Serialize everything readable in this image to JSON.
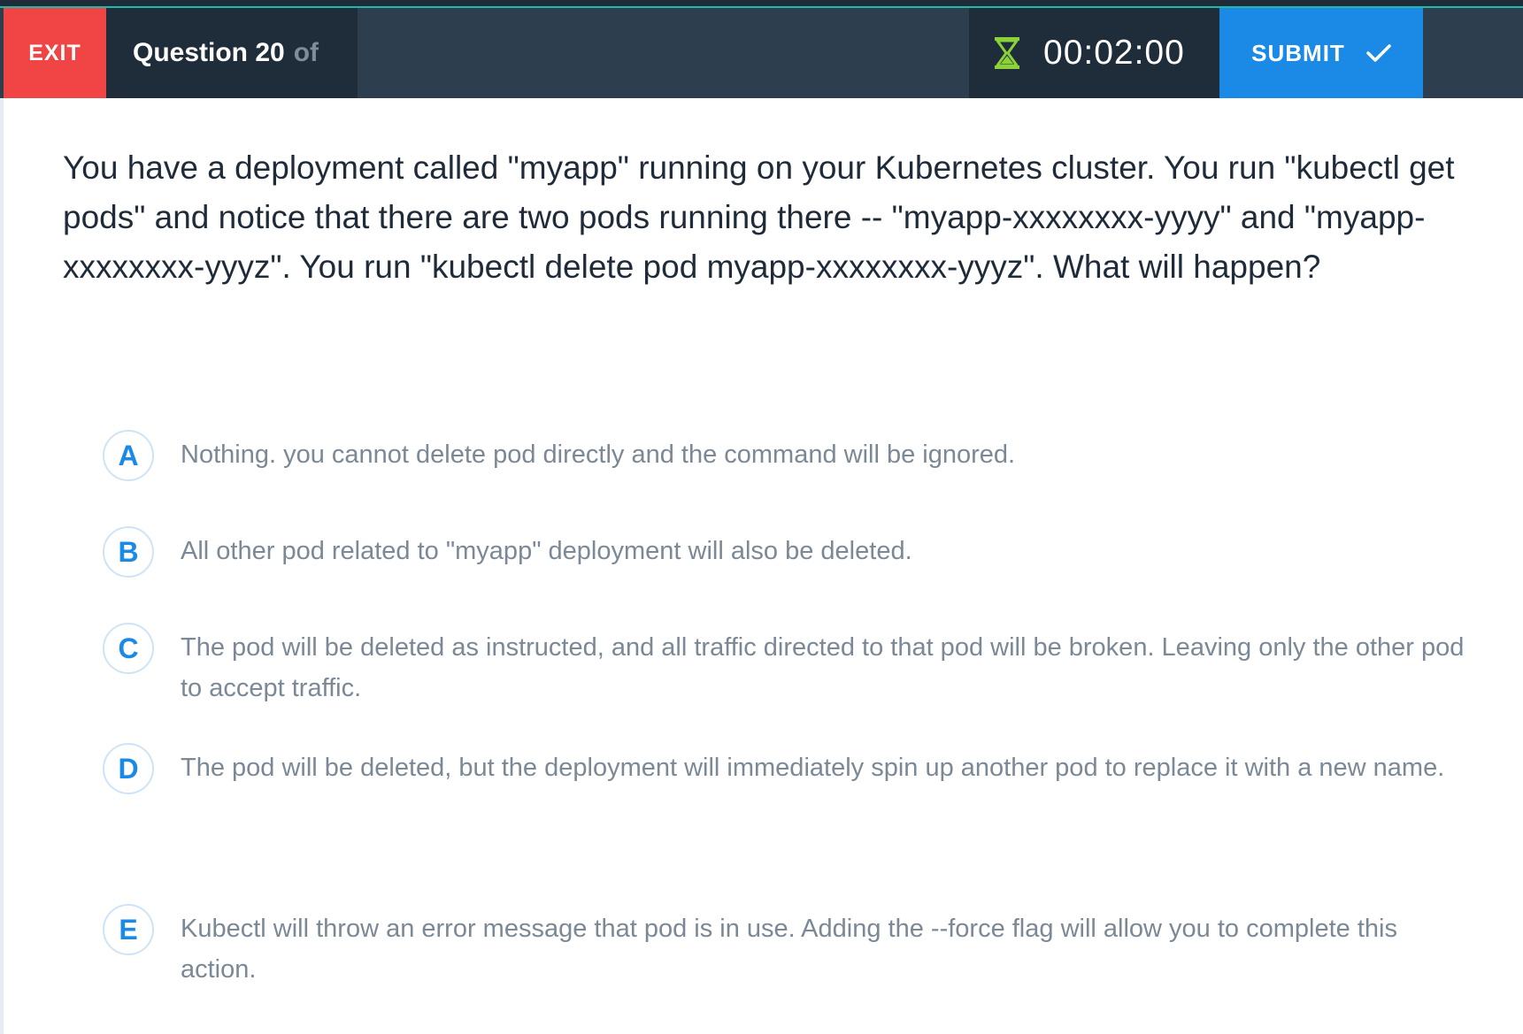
{
  "header": {
    "exit_label": "EXIT",
    "question_label": "Question 20",
    "question_of": "of",
    "timer_value": "00:02:00",
    "submit_label": "SUBMIT",
    "icons": {
      "timer": "hourglass-icon",
      "submit": "checkmark-icon"
    },
    "colors": {
      "exit": "#f14545",
      "submit": "#1a8ae6",
      "bar": "#2d3e4e",
      "accent": "#22b8a6",
      "hourglass": "#8bd23a"
    }
  },
  "question": {
    "text": "You have a deployment called \"myapp\" running on your Kubernetes cluster. You run \"kubectl get pods\" and notice that there are two pods running there -- \"myapp-xxxxxxxx-yyyy\" and \"myapp-xxxxxxxx-yyyz\". You run \"kubectl delete pod myapp-xxxxxxxx-yyyz\". What will happen?"
  },
  "options": [
    {
      "letter": "A",
      "text": "Nothing. you cannot delete pod directly and the command will be ignored."
    },
    {
      "letter": "B",
      "text": "All other pod related to \"myapp\" deployment will also be deleted."
    },
    {
      "letter": "C",
      "text": "The pod will be deleted as instructed, and all traffic directed to that pod will be broken. Leaving only the other pod to accept traffic."
    },
    {
      "letter": "D",
      "text": "The pod will be deleted, but the deployment will immediately spin up another pod to replace it with a new name."
    },
    {
      "letter": "E",
      "text": "Kubectl will throw an error message that pod is in use. Adding the --force flag will allow you to complete this action."
    }
  ]
}
